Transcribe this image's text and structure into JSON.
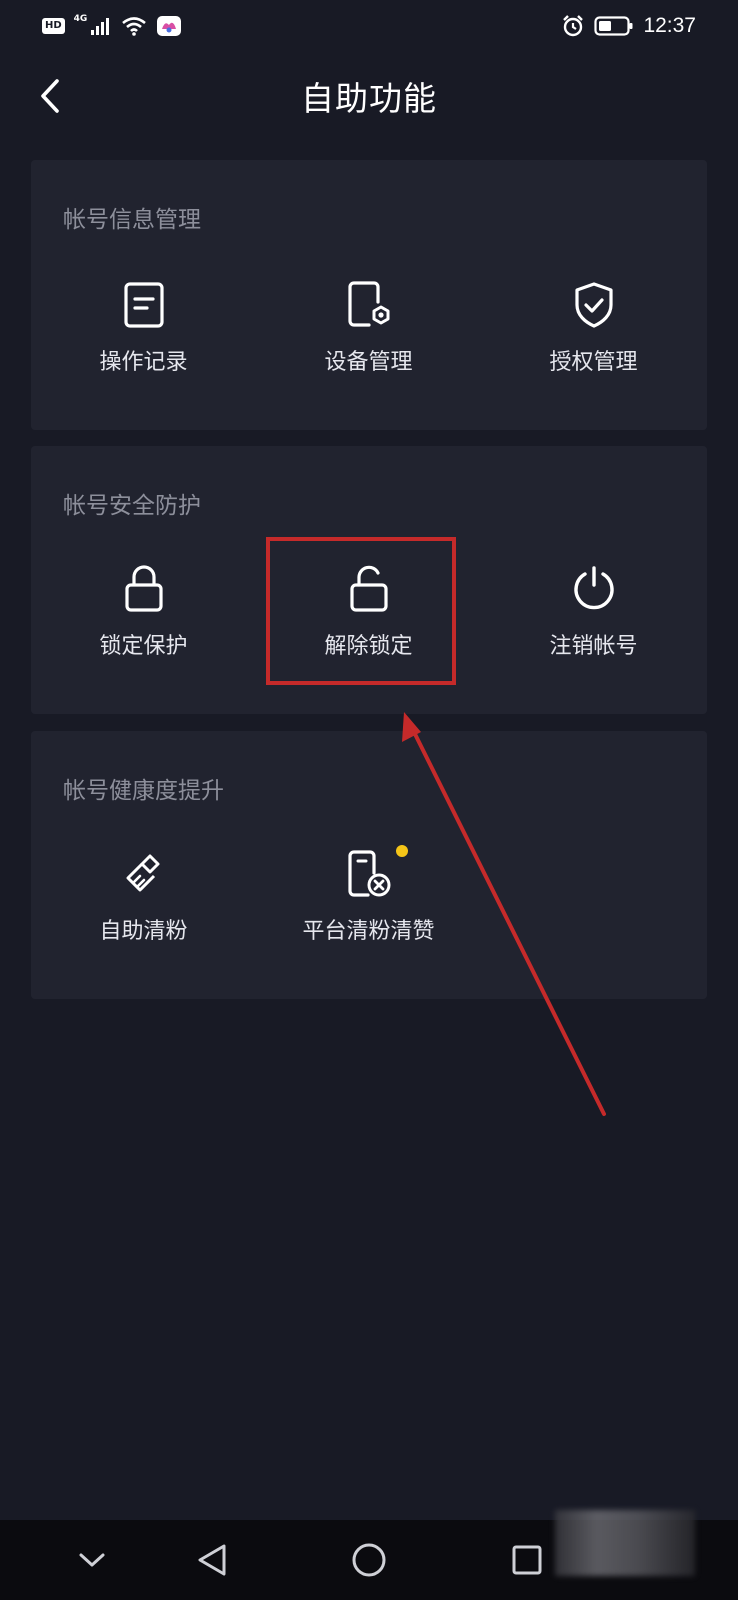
{
  "status_bar": {
    "hd": "HD",
    "network": "4G",
    "time": "12:37"
  },
  "header": {
    "title": "自助功能"
  },
  "sections": [
    {
      "title": "帐号信息管理",
      "items": [
        {
          "label": "操作记录",
          "icon": "document-icon"
        },
        {
          "label": "设备管理",
          "icon": "device-settings-icon"
        },
        {
          "label": "授权管理",
          "icon": "shield-check-icon"
        }
      ]
    },
    {
      "title": "帐号安全防护",
      "items": [
        {
          "label": "锁定保护",
          "icon": "lock-icon"
        },
        {
          "label": "解除锁定",
          "icon": "unlock-icon"
        },
        {
          "label": "注销帐号",
          "icon": "power-icon"
        }
      ]
    },
    {
      "title": "帐号健康度提升",
      "items": [
        {
          "label": "自助清粉",
          "icon": "brush-icon"
        },
        {
          "label": "平台清粉清赞",
          "icon": "phone-remove-icon"
        }
      ]
    }
  ],
  "colors": {
    "background": "#181a25",
    "card": "#21232f",
    "section_title": "#8d8f9b",
    "highlight": "#c52a2a",
    "new_dot": "#f5c518"
  }
}
